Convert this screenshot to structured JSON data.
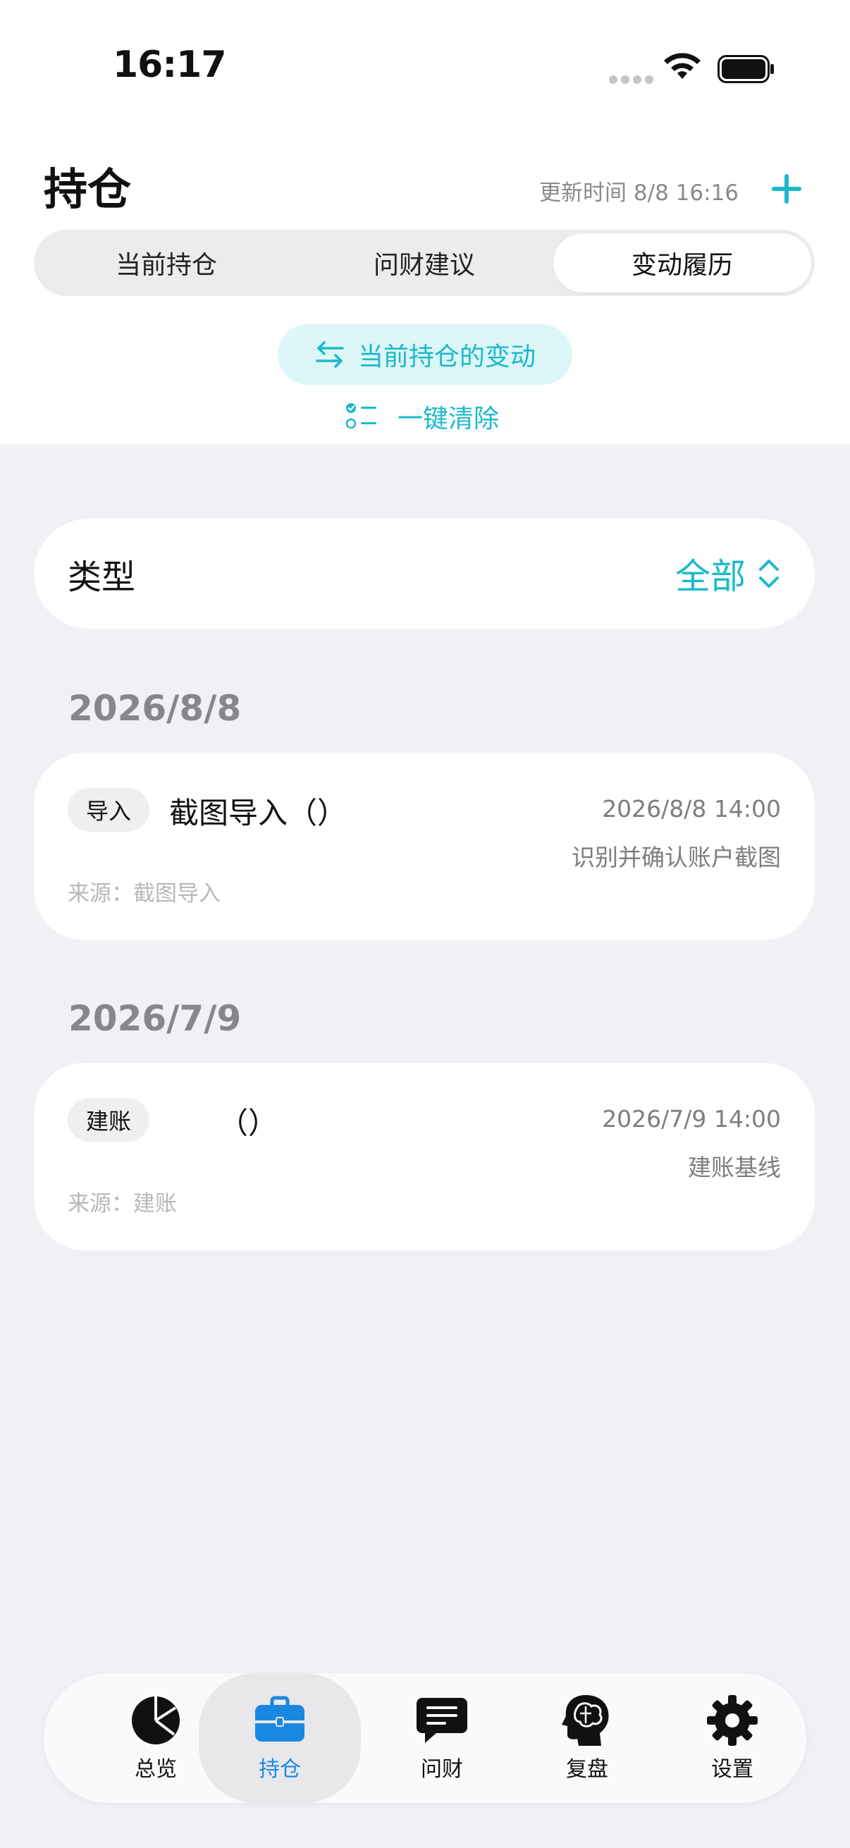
{
  "status_bar": {
    "time": "16:17"
  },
  "header": {
    "title": "持仓",
    "update_time": "更新时间 8/8 16:16"
  },
  "segments": [
    {
      "label": "当前持仓",
      "active": false
    },
    {
      "label": "问财建议",
      "active": false
    },
    {
      "label": "变动履历",
      "active": true
    }
  ],
  "actions": {
    "changes_label": "当前持仓的变动",
    "clear_label": "一键清除"
  },
  "filter": {
    "label": "类型",
    "value": "全部"
  },
  "groups": [
    {
      "date": "2026/8/8",
      "records": [
        {
          "tag": "导入",
          "title": "截图导入（）",
          "time": "2026/8/8 14:00",
          "description": "识别并确认账户截图",
          "source": "来源：截图导入"
        }
      ]
    },
    {
      "date": "2026/7/9",
      "records": [
        {
          "tag": "建账",
          "title": "（）",
          "time": "2026/7/9 14:00",
          "description": "建账基线",
          "source": "来源：建账"
        }
      ]
    }
  ],
  "tabbar": [
    {
      "label": "总览",
      "icon": "pie-chart-icon"
    },
    {
      "label": "持仓",
      "icon": "briefcase-icon",
      "active": true
    },
    {
      "label": "问财",
      "icon": "chat-bubble-icon"
    },
    {
      "label": "复盘",
      "icon": "brain-head-icon"
    },
    {
      "label": "设置",
      "icon": "gear-icon"
    }
  ],
  "colors": {
    "accent": "#1bb9cb",
    "tab_active": "#1a88e0",
    "background": "#f1f1f5"
  }
}
